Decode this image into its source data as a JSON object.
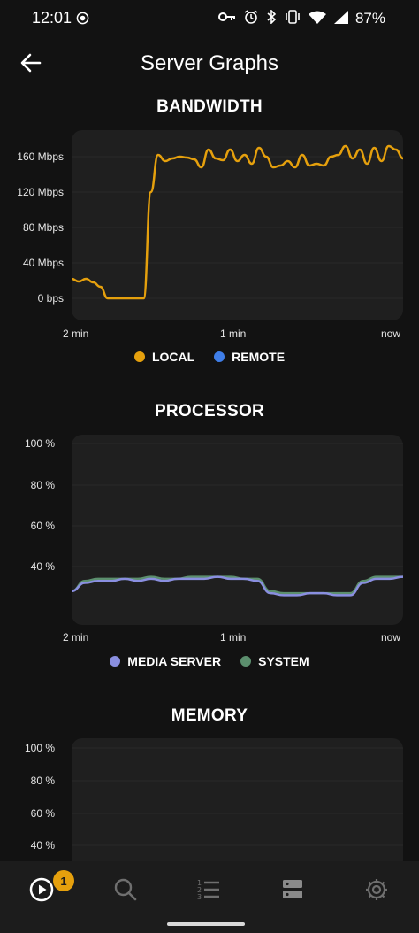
{
  "status_bar": {
    "time": "12:01",
    "battery": "87%"
  },
  "header": {
    "title": "Server Graphs"
  },
  "colors": {
    "local": "#e5a00d",
    "remote": "#3f7ee8",
    "media_server": "#8a8fe0",
    "system": "#5c8f6e",
    "panel": "#1f1f1f"
  },
  "bandwidth": {
    "title": "BANDWIDTH",
    "legend": [
      "LOCAL",
      "REMOTE"
    ],
    "y_ticks": [
      "160 Mbps",
      "120 Mbps",
      "80 Mbps",
      "40 Mbps",
      "0 bps"
    ],
    "x_ticks": [
      "2 min",
      "1 min",
      "now"
    ]
  },
  "processor": {
    "title": "PROCESSOR",
    "legend": [
      "MEDIA SERVER",
      "SYSTEM"
    ],
    "y_ticks": [
      "100 %",
      "80 %",
      "60 %",
      "40 %"
    ],
    "x_ticks": [
      "2 min",
      "1 min",
      "now"
    ]
  },
  "memory": {
    "title": "MEMORY",
    "y_ticks": [
      "100 %",
      "80 %",
      "60 %",
      "40 %"
    ]
  },
  "bottom_nav": {
    "badge_count": "1"
  },
  "chart_data": [
    {
      "type": "line",
      "title": "BANDWIDTH",
      "ylim": [
        0,
        180
      ],
      "y_unit": "Mbps",
      "x_labels": [
        "2 min",
        "1 min",
        "now"
      ],
      "series": [
        {
          "name": "LOCAL",
          "values": [
            22,
            19,
            22,
            18,
            13,
            0,
            0,
            0,
            0,
            0,
            0,
            120,
            162,
            155,
            158,
            160,
            159,
            157,
            148,
            168,
            158,
            156,
            168,
            155,
            162,
            152,
            170,
            160,
            148,
            150,
            155,
            148,
            162,
            150,
            152,
            150,
            160,
            162,
            172,
            158,
            168,
            152,
            170,
            155,
            172,
            168,
            158
          ]
        },
        {
          "name": "REMOTE",
          "values": []
        }
      ]
    },
    {
      "type": "line",
      "title": "PROCESSOR",
      "ylim": [
        0,
        100
      ],
      "y_unit": "%",
      "x_labels": [
        "2 min",
        "1 min",
        "now"
      ],
      "series": [
        {
          "name": "MEDIA SERVER",
          "values": [
            28,
            32,
            33,
            33,
            34,
            33,
            34,
            33,
            34,
            34,
            34,
            35,
            34,
            34,
            33,
            27,
            26,
            26,
            27,
            27,
            26,
            26,
            32,
            34,
            34,
            35
          ]
        },
        {
          "name": "SYSTEM",
          "values": [
            28,
            33,
            34,
            34,
            34,
            34,
            35,
            34,
            34,
            35,
            35,
            35,
            35,
            34,
            34,
            28,
            27,
            27,
            27,
            27,
            27,
            27,
            33,
            35,
            35,
            35
          ]
        }
      ]
    },
    {
      "type": "line",
      "title": "MEMORY",
      "ylim": [
        0,
        100
      ],
      "y_unit": "%",
      "series": []
    }
  ]
}
